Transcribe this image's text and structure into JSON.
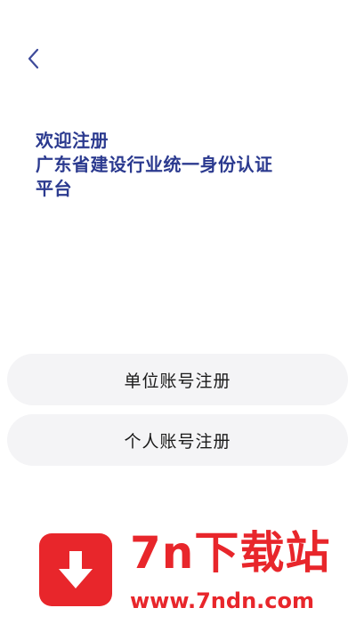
{
  "nav": {
    "back_icon": "chevron-left-icon"
  },
  "heading": {
    "line1": "欢迎注册",
    "line2": "广东省建设行业统一身份认证",
    "line3": "平台"
  },
  "options": {
    "unit_label": "单位账号注册",
    "personal_label": "个人账号注册"
  },
  "watermark": {
    "icon": "download-icon",
    "title": "7n下载站",
    "url": "www.7ndn.com"
  },
  "colors": {
    "heading": "#2b3a8f",
    "back_icon": "#3d4a9a",
    "button_bg": "#f4f4f6",
    "watermark_red": "#e8262b"
  }
}
